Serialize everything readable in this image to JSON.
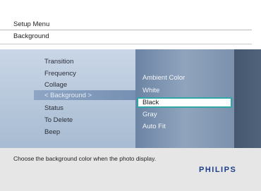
{
  "header": {
    "title": "Setup Menu",
    "subtitle": "Background"
  },
  "menu": {
    "items": [
      {
        "label": "Transition"
      },
      {
        "label": "Frequency"
      },
      {
        "label": "Collage"
      },
      {
        "label": "< Background >"
      },
      {
        "label": "Status"
      },
      {
        "label": "To Delete"
      },
      {
        "label": "Beep"
      }
    ],
    "selected_index": 3
  },
  "options": {
    "items": [
      {
        "label": "Ambient Color"
      },
      {
        "label": "White"
      },
      {
        "label": "Black"
      },
      {
        "label": "Gray"
      },
      {
        "label": "Auto Fit"
      }
    ],
    "selected_index": 2
  },
  "footer": {
    "help": "Choose the background color when the photo display.",
    "logo": "PHILIPS"
  },
  "colors": {
    "accent": "#2fa7aa",
    "brand": "#1c3d8a"
  }
}
